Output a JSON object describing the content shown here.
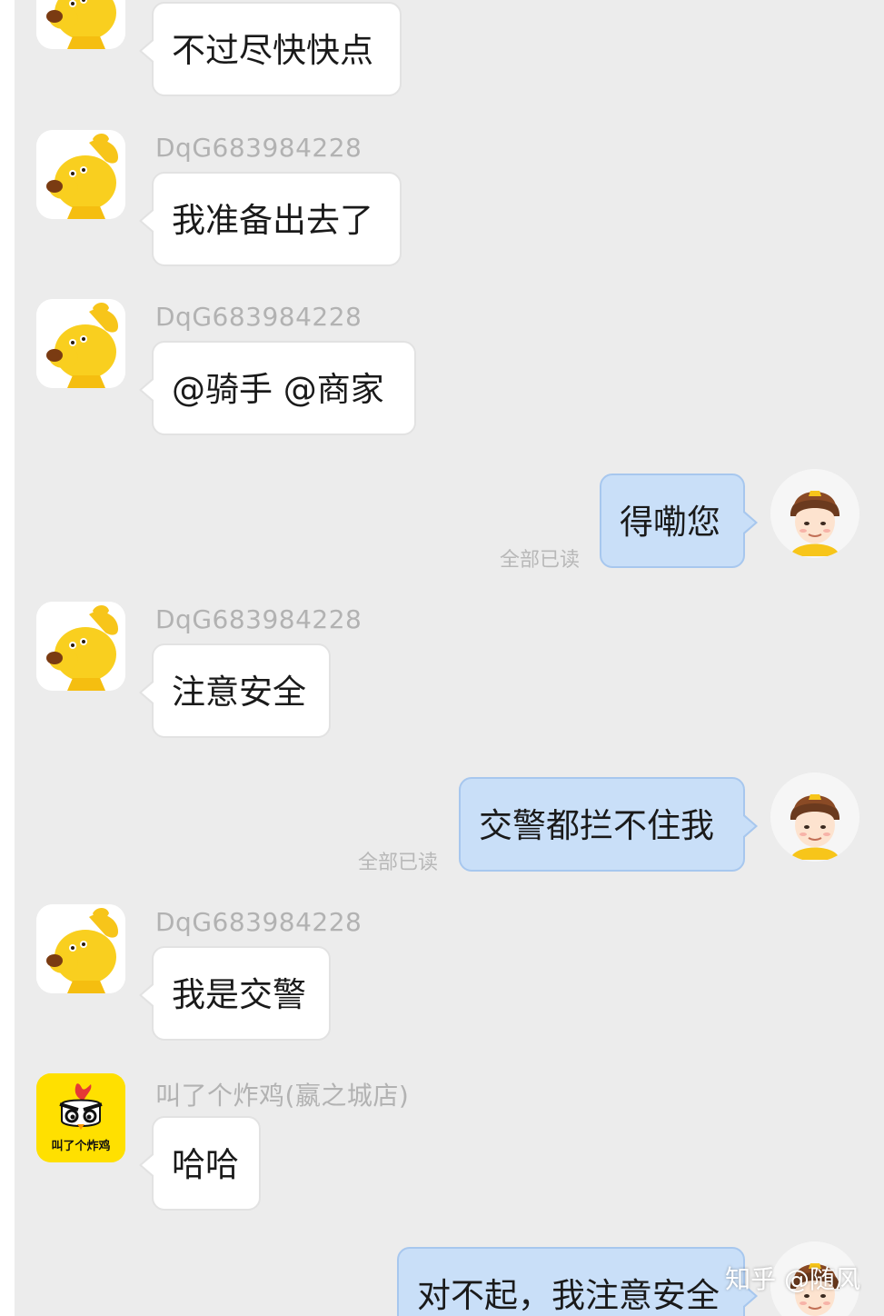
{
  "messages": [
    {
      "sender": "",
      "text": "不过尽快快点"
    },
    {
      "sender": "DqG683984228",
      "text": "我准备出去了"
    },
    {
      "sender": "DqG683984228",
      "text": "@骑手 @商家"
    },
    {
      "text": "得嘞您",
      "status": "全部已读"
    },
    {
      "sender": "DqG683984228",
      "text": "注意安全"
    },
    {
      "text": "交警都拦不住我",
      "status": "全部已读"
    },
    {
      "sender": "DqG683984228",
      "text": "我是交警"
    },
    {
      "sender": "叫了个炸鸡(嬴之城店)",
      "text": "哈哈"
    },
    {
      "text": "对不起，我注意安全"
    }
  ],
  "store_logo_text": "叫了个炸鸡",
  "watermark": "知乎 @随风",
  "colors": {
    "background": "#ececec",
    "incoming_bubble": "#ffffff",
    "outgoing_bubble": "#c9dff8",
    "outgoing_border": "#a7c7ee",
    "meta_text": "#b2b2b2",
    "store_avatar": "#ffe000"
  },
  "icons": {
    "customer_avatar": "yellow-dog-avatar",
    "rider_avatar": "helmet-rider-avatar",
    "store_avatar": "fried-chicken-logo-avatar"
  }
}
